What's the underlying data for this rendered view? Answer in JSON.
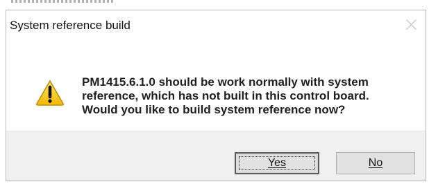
{
  "dialog": {
    "title": "System reference build",
    "close_icon": "close-icon",
    "warning_icon": "warning-triangle-icon",
    "message_lines": [
      "PM1415.6.1.0   should be work normally with system",
      "reference, which has not built in this control board.",
      "Would you like to build system reference now?"
    ],
    "buttons": {
      "yes": "Yes",
      "no": "No"
    },
    "colors": {
      "footer": "#f0f0f0",
      "button_face": "#e1e1e1",
      "warning_yellow": "#f7c82f",
      "text": "#1f1f1f"
    }
  }
}
